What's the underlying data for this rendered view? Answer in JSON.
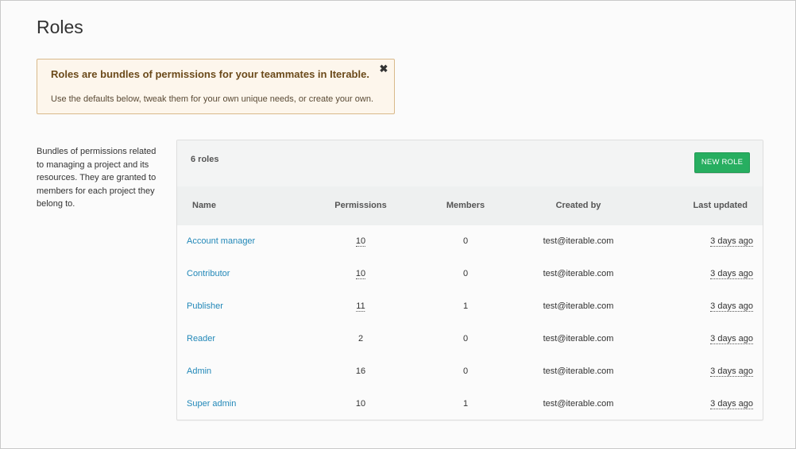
{
  "page": {
    "title": "Roles"
  },
  "banner": {
    "title": "Roles are bundles of permissions for your teammates in Iterable.",
    "text": "Use the defaults below, tweak them for your own unique needs, or create your own.",
    "close_icon": "close-icon",
    "close_glyph": "✖"
  },
  "sidebar": {
    "description": "Bundles of permissions related to managing a project and its resources. They are granted to members for each project they belong to."
  },
  "table": {
    "count_label": "6 roles",
    "new_role_label": "NEW ROLE",
    "accent_color": "#27ae60",
    "link_color": "#2288b8",
    "columns": {
      "name": "Name",
      "permissions": "Permissions",
      "members": "Members",
      "created_by": "Created by",
      "last_updated": "Last updated"
    },
    "rows": [
      {
        "name": "Account manager",
        "permissions": "10",
        "members": "0",
        "created_by": "test@iterable.com",
        "last_updated": "3 days ago"
      },
      {
        "name": "Contributor",
        "permissions": "10",
        "members": "0",
        "created_by": "test@iterable.com",
        "last_updated": "3 days ago"
      },
      {
        "name": "Publisher",
        "permissions": "11",
        "members": "1",
        "created_by": "test@iterable.com",
        "last_updated": "3 days ago"
      },
      {
        "name": "Reader",
        "permissions": "2",
        "members": "0",
        "created_by": "test@iterable.com",
        "last_updated": "3 days ago"
      },
      {
        "name": "Admin",
        "permissions": "16",
        "members": "0",
        "created_by": "test@iterable.com",
        "last_updated": "3 days ago"
      },
      {
        "name": "Super admin",
        "permissions": "10",
        "members": "1",
        "created_by": "test@iterable.com",
        "last_updated": "3 days ago"
      }
    ]
  }
}
